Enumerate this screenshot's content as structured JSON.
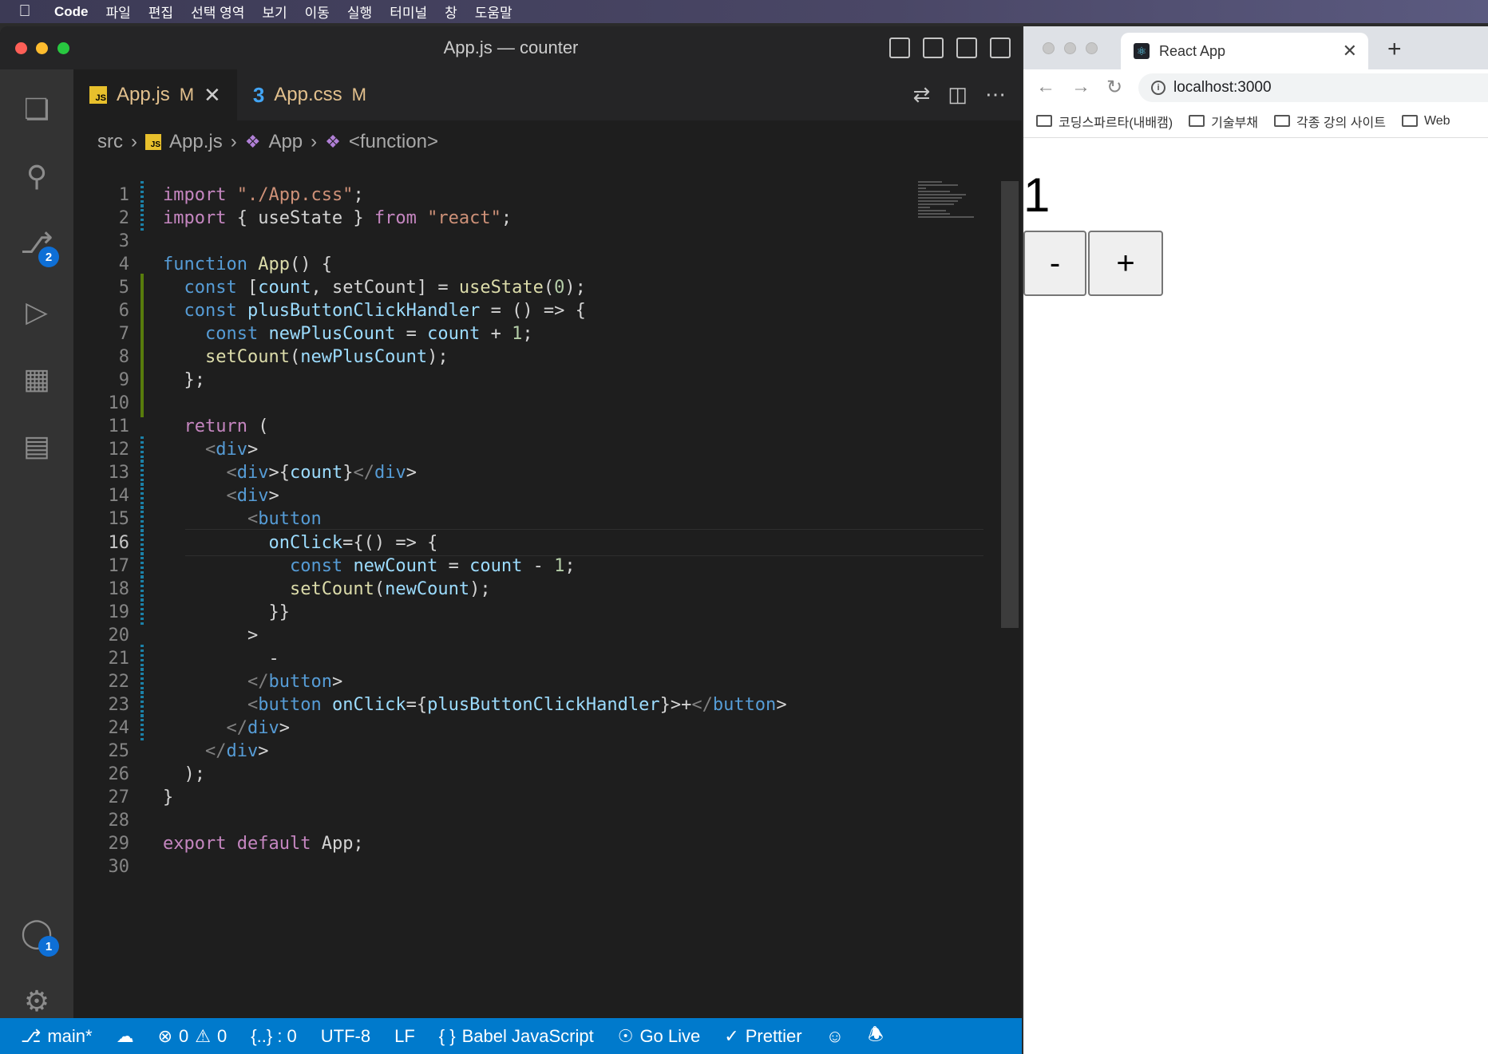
{
  "menubar": {
    "app_name": "Code",
    "items": [
      "파일",
      "편집",
      "선택 영역",
      "보기",
      "이동",
      "실행",
      "터미널",
      "창",
      "도움말"
    ]
  },
  "vscode": {
    "title": "App.js — counter",
    "tabs": [
      {
        "label": "App.js",
        "modified": "M",
        "active": true
      },
      {
        "label": "App.css",
        "modified": "M",
        "active": false
      }
    ],
    "breadcrumb": [
      "src",
      "App.js",
      "App",
      "<function>"
    ],
    "activity_badges": {
      "source_control": "2",
      "accounts": "1"
    },
    "code_lines": [
      "import \"./App.css\";",
      "import { useState } from \"react\";",
      "",
      "function App() {",
      "  const [count, setCount] = useState(0);",
      "  const plusButtonClickHandler = () => {",
      "    const newPlusCount = count + 1;",
      "    setCount(newPlusCount);",
      "  };",
      "",
      "  return (",
      "    <div>",
      "      <div>{count}</div>",
      "      <div>",
      "        <button",
      "          onClick={() => {",
      "            const newCount = count - 1;",
      "            setCount(newCount);",
      "          }}",
      "        >",
      "          -",
      "        </button>",
      "        <button onClick={plusButtonClickHandler}>+</button>",
      "      </div>",
      "    </div>",
      "  );",
      "}",
      "",
      "export default App;",
      ""
    ],
    "current_line": 16,
    "statusbar": {
      "branch": "main*",
      "errors": "0",
      "warnings": "0",
      "braces": "{..} : 0",
      "encoding": "UTF-8",
      "eol": "LF",
      "language": "Babel JavaScript",
      "golive": "Go Live",
      "prettier": "Prettier"
    }
  },
  "browser": {
    "tab_title": "React App",
    "url": "localhost:3000",
    "bookmarks": [
      "코딩스파르타(내배캠)",
      "기술부채",
      "각종 강의 사이트",
      "Web"
    ],
    "page": {
      "count": "1",
      "minus_label": "-",
      "plus_label": "+"
    }
  },
  "colors": {
    "statusbar": "#007acc",
    "editor_bg": "#1e1e1e",
    "badge": "#0e6fd6"
  }
}
